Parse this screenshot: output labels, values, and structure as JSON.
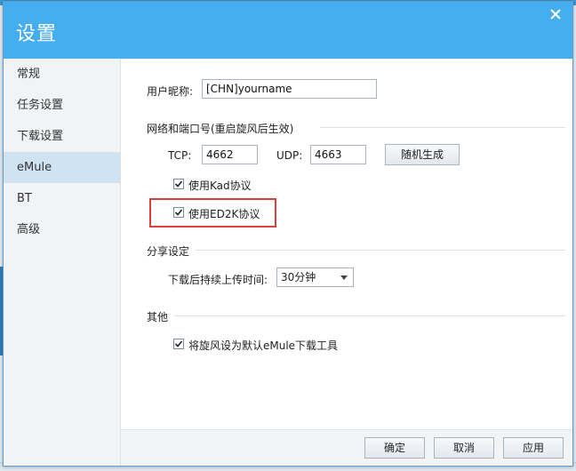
{
  "dialog": {
    "title": "设置",
    "close_glyph": "✕"
  },
  "sidebar": {
    "items": [
      {
        "label": "常规"
      },
      {
        "label": "任务设置"
      },
      {
        "label": "下载设置"
      },
      {
        "label": "eMule"
      },
      {
        "label": "BT"
      },
      {
        "label": "高级"
      }
    ],
    "active_index": 3
  },
  "emule": {
    "nickname_label": "用户昵称:",
    "nickname_value": "[CHN]yourname",
    "network_section": "网络和端口号(重启旋风后生效)",
    "tcp_label": "TCP:",
    "tcp_value": "4662",
    "udp_label": "UDP:",
    "udp_value": "4663",
    "random_button": "随机生成",
    "kad_label": "使用Kad协议",
    "kad_checked": true,
    "ed2k_label": "使用ED2K协议",
    "ed2k_checked": true,
    "share_section": "分享设定",
    "upload_time_label": "下载后持续上传时间:",
    "upload_time_value": "30分钟",
    "other_section": "其他",
    "default_tool_label": "将旋风设为默认eMule下载工具",
    "default_tool_checked": true
  },
  "footer": {
    "ok_label": "确定",
    "cancel_label": "取消",
    "apply_label": "应用"
  },
  "colors": {
    "titlebar": "#45aef0",
    "sidebar_active": "#cfe3f3",
    "highlight": "#d9403a"
  }
}
